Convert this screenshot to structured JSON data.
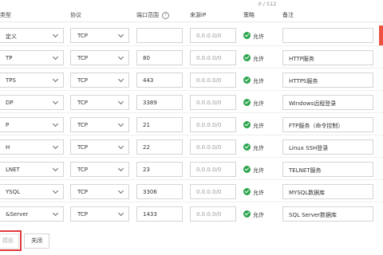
{
  "counter": "0 / 512",
  "headers": {
    "type": "类型",
    "protocol": "协议",
    "port": "端口范围",
    "source": "来源IP",
    "policy": "策略",
    "remark": "备注"
  },
  "rows": [
    {
      "type": "定义",
      "protocol": "TCP",
      "port": "",
      "source": "0.0.0.0/0",
      "policy": "允许",
      "remark": ""
    },
    {
      "type": "TP",
      "protocol": "TCP",
      "port": "80",
      "source": "0.0.0.0/0",
      "policy": "允许",
      "remark": "HTTP服务"
    },
    {
      "type": "TPS",
      "protocol": "TCP",
      "port": "443",
      "source": "0.0.0.0/0",
      "policy": "允许",
      "remark": "HTTPS服务"
    },
    {
      "type": "DP",
      "protocol": "TCP",
      "port": "3389",
      "source": "0.0.0.0/0",
      "policy": "允许",
      "remark": "Windows远程登录"
    },
    {
      "type": "P",
      "protocol": "TCP",
      "port": "21",
      "source": "0.0.0.0/0",
      "policy": "允许",
      "remark": "FTP服务（命令控制）"
    },
    {
      "type": "H",
      "protocol": "TCP",
      "port": "22",
      "source": "0.0.0.0/0",
      "policy": "允许",
      "remark": "Linux SSH登录"
    },
    {
      "type": "LNET",
      "protocol": "TCP",
      "port": "23",
      "source": "0.0.0.0/0",
      "policy": "允许",
      "remark": "TELNET服务"
    },
    {
      "type": "YSQL",
      "protocol": "TCP",
      "port": "3306",
      "source": "0.0.0.0/0",
      "policy": "允许",
      "remark": "MYSQL数据库"
    },
    {
      "type": "&Server",
      "protocol": "TCP",
      "port": "1433",
      "source": "0.0.0.0/0",
      "policy": "允许",
      "remark": "SQL Server数据库"
    }
  ],
  "footer": {
    "first_button": "模板",
    "close_button": "关闭"
  },
  "colors": {
    "allow_green": "#2ca64e",
    "highlight_red": "#e0393d",
    "accent_red": "#ee5342"
  }
}
